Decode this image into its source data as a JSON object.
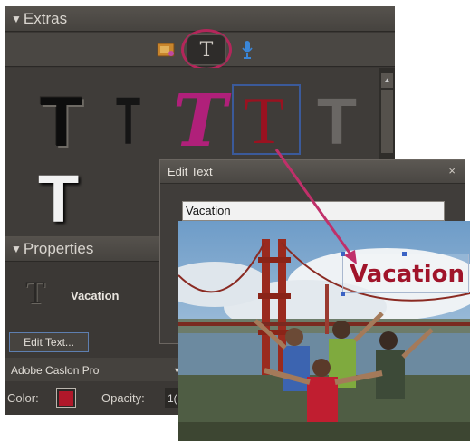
{
  "extras_header": {
    "arrow": "▼",
    "label": "Extras"
  },
  "tabs": {
    "text_tab_glyph": "T"
  },
  "text_styles": [
    {
      "glyph": "T",
      "name": "black-bevel-style"
    },
    {
      "glyph": "T",
      "name": "black-thin-style"
    },
    {
      "glyph": "T",
      "name": "magenta-italic-style"
    },
    {
      "glyph": "T",
      "name": "red-serif-style"
    },
    {
      "glyph": "T",
      "name": "gray-style"
    },
    {
      "glyph": "T",
      "name": "white-shadow-style"
    }
  ],
  "properties_header": {
    "arrow": "▼",
    "label": "Properties"
  },
  "properties": {
    "preview_glyph": "T",
    "layer_label": "Vacation",
    "edit_button": "Edit Text...",
    "font_family": "Adobe Caslon Pro",
    "color_label": "Color:",
    "opacity_label": "Opacity:",
    "opacity_value": "1(",
    "color_value": "#b0182a"
  },
  "edit_dialog": {
    "title": "Edit Text",
    "close": "×",
    "text_value": "Vacation"
  },
  "photo": {
    "overlay_text": "Vacation"
  },
  "colors": {
    "accent_ring": "#b3265a",
    "arrow": "#c0306a",
    "selection": "#3b5a9a",
    "text_red": "#a0142a"
  }
}
